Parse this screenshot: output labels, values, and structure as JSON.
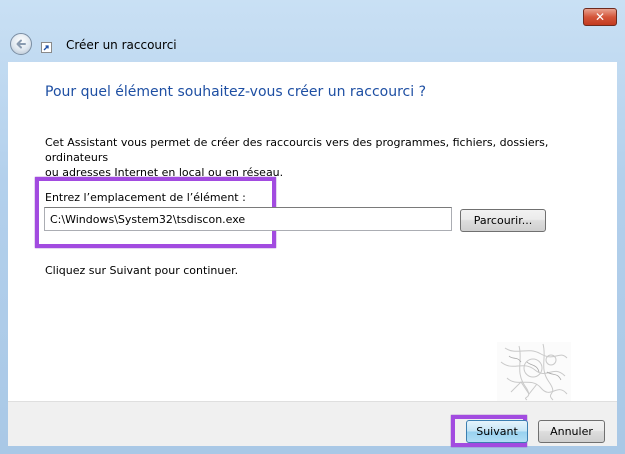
{
  "window": {
    "title": "Créer un raccourci",
    "close_label": "✕"
  },
  "page": {
    "heading": "Pour quel élément souhaitez-vous créer un raccourci ?",
    "intro_line1": "Cet Assistant vous permet de créer des raccourcis vers des programmes, fichiers, dossiers, ordinateurs",
    "intro_line2": "ou adresses Internet en local ou en réseau.",
    "location_label": "Entrez l’emplacement de l’élément :",
    "location_value": "C:\\Windows\\System32\\tsdiscon.exe",
    "browse_label": "Parcourir...",
    "continue_text": "Cliquez sur Suivant pour continuer."
  },
  "footer": {
    "next_label": "Suivant",
    "cancel_label": "Annuler"
  },
  "colors": {
    "heading": "#1e4fa3",
    "highlight": "#a24be0",
    "close_button": "#c23a1f"
  },
  "icons": [
    "back-arrow-icon",
    "shortcut-icon",
    "close-icon",
    "watermark-image"
  ]
}
